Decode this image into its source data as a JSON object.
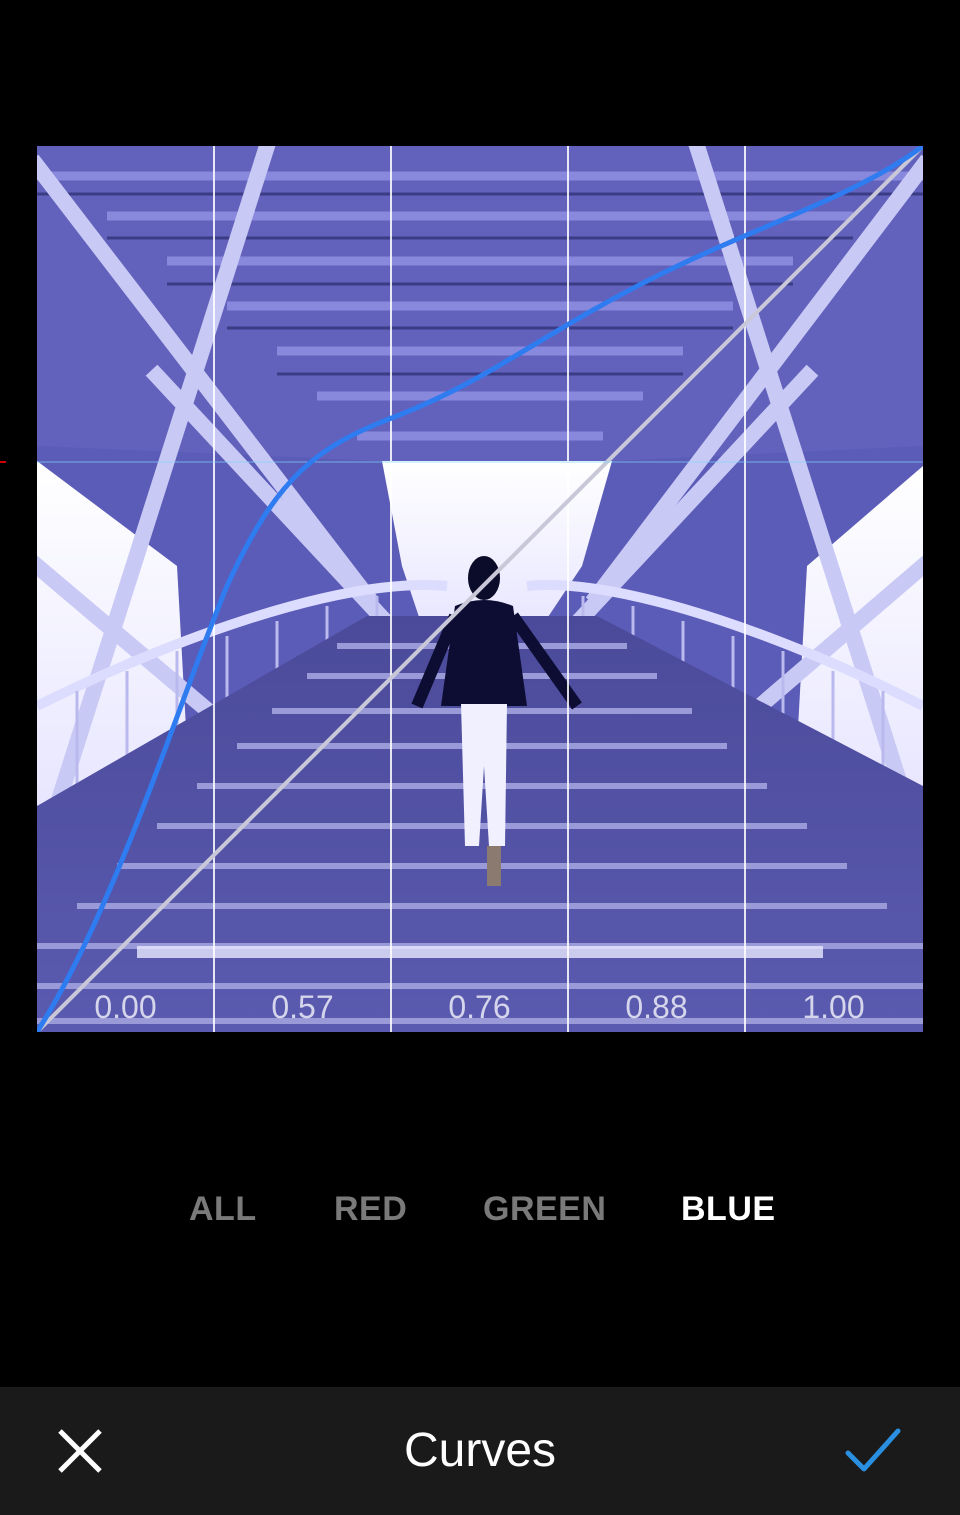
{
  "curves_panel": {
    "grid_values": [
      "0.00",
      "0.57",
      "0.76",
      "0.88",
      "1.00"
    ],
    "selected_channel": "BLUE",
    "curve_color": "#2f7bf0"
  },
  "channels": [
    {
      "label": "ALL"
    },
    {
      "label": "RED"
    },
    {
      "label": "GREEN"
    },
    {
      "label": "BLUE"
    }
  ],
  "bottom_bar": {
    "title": "Curves",
    "cancel_icon": "close-icon",
    "apply_icon": "checkmark-icon",
    "apply_color": "#2a8fe0"
  }
}
